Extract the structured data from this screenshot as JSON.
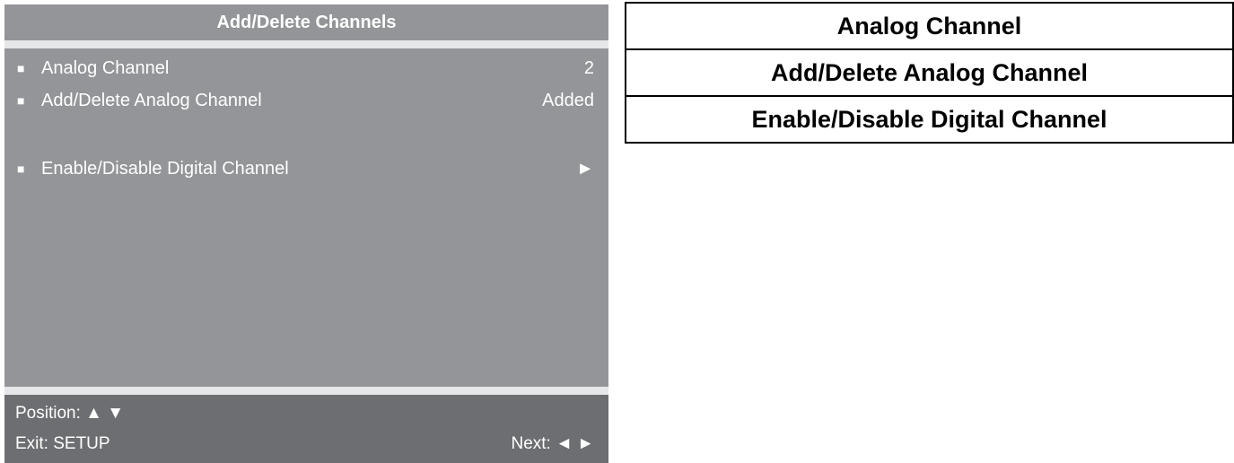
{
  "osd": {
    "title": "Add/Delete Channels",
    "items": [
      {
        "bullet": "■",
        "label": "Analog Channel",
        "value": "2"
      },
      {
        "bullet": "■",
        "label": "Add/Delete Analog Channel",
        "value": "Added"
      },
      {
        "bullet": "■",
        "label": "Enable/Disable Digital Channel",
        "value": "►"
      }
    ],
    "footer": {
      "position": "Position: ▲ ▼",
      "exit": "Exit: SETUP",
      "next": "Next: ◄ ►"
    },
    "colors": {
      "panel": "#939598",
      "rule": "#e6e7e8",
      "footer": "#6d6e71",
      "text": "#ffffff"
    }
  },
  "reference_table": {
    "rows": [
      "Analog Channel",
      "Add/Delete Analog Channel",
      "Enable/Disable Digital Channel"
    ]
  }
}
